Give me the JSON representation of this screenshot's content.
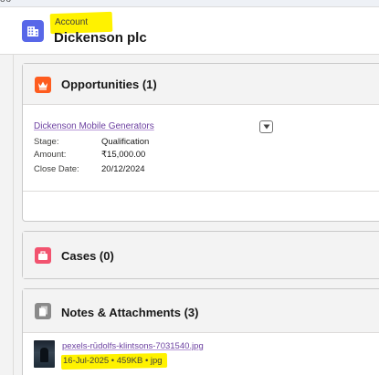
{
  "header": {
    "object_type": "Account",
    "record_name": "Dickenson plc",
    "top_dots": "oo",
    "icon": "building-icon"
  },
  "opportunities": {
    "title": "Opportunities (1)",
    "icon": "crown-icon",
    "icon_color": "#fe5c1f",
    "record": {
      "name": "Dickenson Mobile Generators",
      "fields": [
        {
          "label": "Stage:",
          "value": "Qualification"
        },
        {
          "label": "Amount:",
          "value": "₹15,000.00"
        },
        {
          "label": "Close Date:",
          "value": "20/12/2024"
        }
      ]
    }
  },
  "cases": {
    "title": "Cases (0)",
    "icon": "briefcase-icon",
    "icon_color": "#f2536f"
  },
  "notes": {
    "title": "Notes & Attachments (3)",
    "icon": "file-icon",
    "icon_color": "#8a8a8a",
    "attachment": {
      "filename": "pexels-rūdolfs-klintsons-7031540.jpg",
      "meta": "16-Jul-2025 • 459KB • jpg"
    }
  },
  "colors": {
    "account_icon": "#5867e8",
    "link": "#6b3fa0",
    "highlight": "#fff200"
  }
}
